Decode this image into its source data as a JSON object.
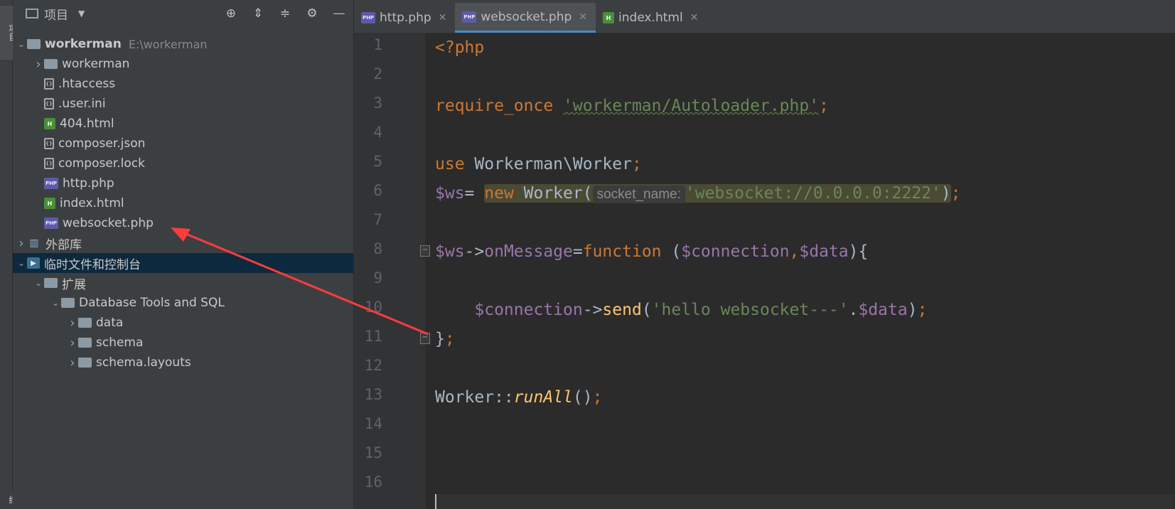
{
  "left_strip": {
    "tab_label": "项目",
    "bottom_label": "结"
  },
  "project_panel": {
    "title": "项目",
    "tools": [
      "locate-icon",
      "expand-all-icon",
      "collapse-all-icon",
      "gear-icon",
      "minimize-icon"
    ],
    "tree": [
      {
        "label": "workerman",
        "sub": "E:\\workerman",
        "icon": "folder",
        "arrow": "down",
        "indent": 0
      },
      {
        "label": "workerman",
        "icon": "folder",
        "arrow": "right",
        "indent": 1
      },
      {
        "label": ".htaccess",
        "icon": "file",
        "indent": 1
      },
      {
        "label": ".user.ini",
        "icon": "file",
        "indent": 1
      },
      {
        "label": "404.html",
        "icon": "html",
        "indent": 1
      },
      {
        "label": "composer.json",
        "icon": "file",
        "indent": 1
      },
      {
        "label": "composer.lock",
        "icon": "file",
        "indent": 1
      },
      {
        "label": "http.php",
        "icon": "php",
        "indent": 1
      },
      {
        "label": "index.html",
        "icon": "html",
        "indent": 1
      },
      {
        "label": "websocket.php",
        "icon": "php",
        "indent": 1
      },
      {
        "label": "外部库",
        "icon": "lib",
        "arrow": "right",
        "indent": 0
      },
      {
        "label": "临时文件和控制台",
        "icon": "scratch",
        "arrow": "down",
        "indent": 0,
        "selected": true
      },
      {
        "label": "扩展",
        "icon": "folder",
        "arrow": "down",
        "indent": 1
      },
      {
        "label": "Database Tools and SQL",
        "icon": "folder",
        "arrow": "down",
        "indent": 2
      },
      {
        "label": "data",
        "icon": "folder",
        "arrow": "right",
        "indent": 3
      },
      {
        "label": "schema",
        "icon": "folder",
        "arrow": "right",
        "indent": 3
      },
      {
        "label": "schema.layouts",
        "icon": "folder",
        "arrow": "right",
        "indent": 3
      }
    ]
  },
  "editor": {
    "tabs": [
      {
        "label": "http.php",
        "icon": "php",
        "active": false
      },
      {
        "label": "websocket.php",
        "icon": "php",
        "active": true
      },
      {
        "label": "index.html",
        "icon": "html",
        "active": false
      }
    ],
    "line_numbers": [
      "1",
      "2",
      "3",
      "4",
      "5",
      "6",
      "7",
      "8",
      "9",
      "10",
      "11",
      "12",
      "13",
      "14",
      "15",
      "16"
    ],
    "code": {
      "l1": "<?php",
      "l3_kw": "require_once",
      "l3_str": "'workerman/Autoloader.php'",
      "l3_end": ";",
      "l5_kw": "use",
      "l5_ns": " Workerman\\Worker",
      "l5_end": ";",
      "l6_var": "$ws",
      "l6_eq": "= ",
      "l6_new": "new",
      "l6_cls": " Worker(",
      "l6_hint": "socket_name:",
      "l6_str": "'websocket://0.0.0.0:2222'",
      "l6_close": ")",
      "l6_end": ";",
      "l8_var": "$ws",
      "l8_arrow": "->",
      "l8_prop": "onMessage",
      "l8_eq": "=",
      "l8_fn": "function",
      "l8_paren": " (",
      "l8_p1": "$connection",
      "l8_comma": ",",
      "l8_p2": "$data",
      "l8_close": "){",
      "l10_var": "$connection",
      "l10_arrow": "->",
      "l10_fn": "send",
      "l10_open": "(",
      "l10_str": "'hello websocket---'",
      "l10_dot": ".",
      "l10_var2": "$data",
      "l10_close": ")",
      "l10_end": ";",
      "l11_brace": "}",
      "l11_end": ";",
      "l13_cls": "Worker::",
      "l13_fn": "runAll",
      "l13_paren": "()",
      "l13_end": ";"
    }
  },
  "annotation": {
    "color": "#ff3b3b"
  }
}
